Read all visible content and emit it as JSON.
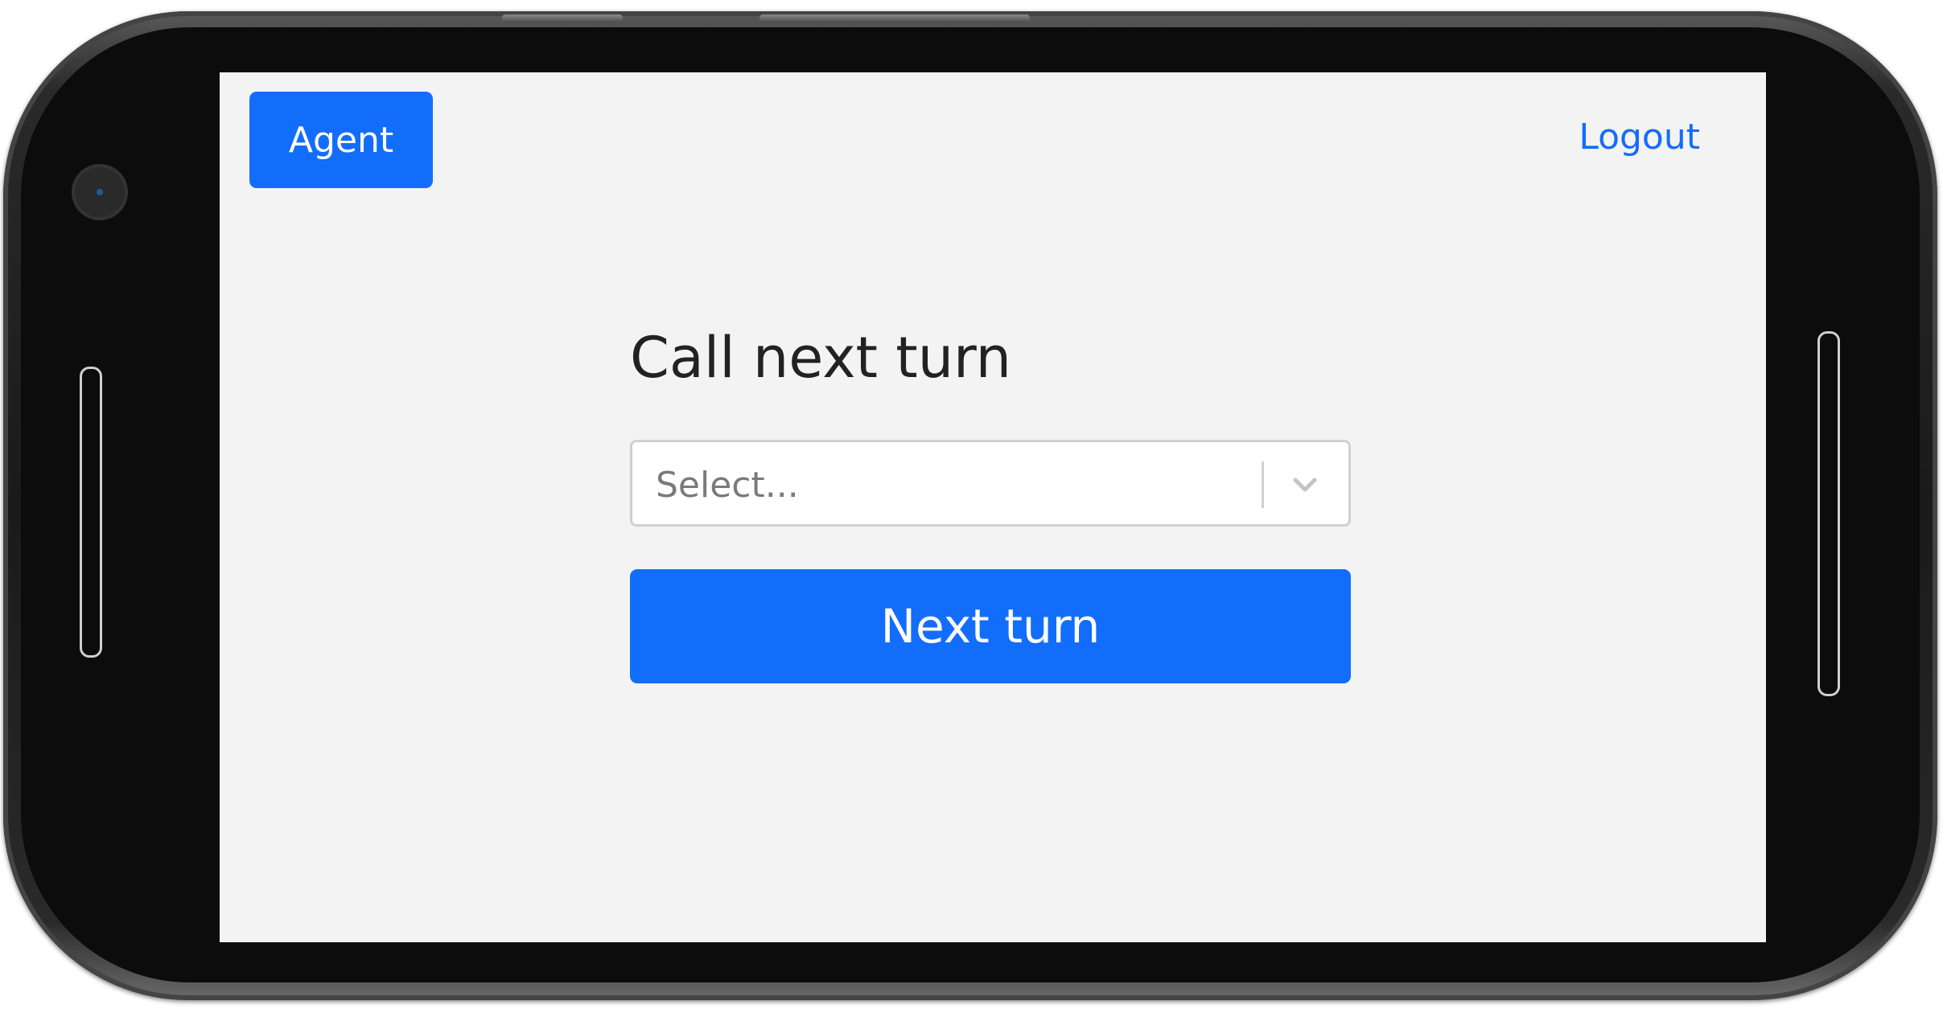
{
  "header": {
    "agent_label": "Agent",
    "logout_label": "Logout"
  },
  "main": {
    "title": "Call next turn",
    "select": {
      "placeholder": "Select..."
    },
    "next_button_label": "Next turn"
  },
  "colors": {
    "primary": "#136dfb",
    "screen_background": "#f3f3f3",
    "device_body": "#0c0c0c"
  },
  "icons": {
    "select_indicator": "chevron-down-icon"
  }
}
